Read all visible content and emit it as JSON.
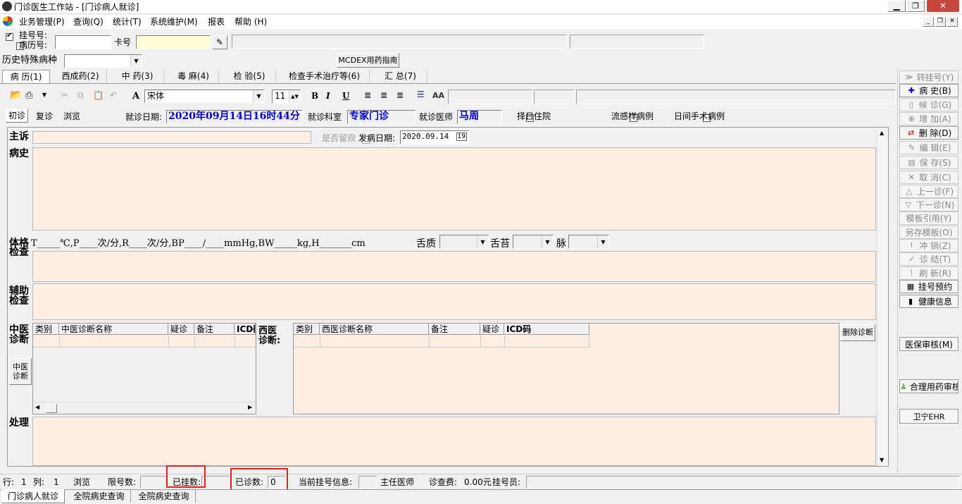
{
  "window": {
    "title": "门诊医生工作站 - [门诊病人就诊]"
  },
  "menu": [
    "业务管理(P)",
    "查询(Q)",
    "统计(T)",
    "系统维护(M)",
    "报表",
    "帮助 (H)"
  ],
  "patient_bar": {
    "reg_no_label": "挂号号:",
    "record_no_label": "病历号:",
    "card_label": "卡号",
    "reg_no_checked": true,
    "record_no_checked": false
  },
  "history": {
    "label": "历史特殊病种",
    "mcdex_button": "MCDEX用药指南"
  },
  "tabs": [
    "病 历(1)",
    "西成药(2)",
    "中 药(3)",
    "毒 麻(4)",
    "检 验(5)",
    "检查手术治疗等(6)",
    "汇 总(7)"
  ],
  "toolbar": {
    "font": "宋体",
    "size": "11",
    "bold": "B",
    "italic": "I",
    "underline": "U"
  },
  "visit": {
    "first": "初诊",
    "revisit": "复诊",
    "browse": "浏览",
    "date_label": "就诊日期:",
    "date_value": "2020年09月14日16时44分",
    "dept_label": "就诊科室",
    "dept_value": "专家门诊",
    "doctor_label": "就诊医师",
    "doctor_value": "马周",
    "select_day": "择日住院",
    "flu_case": "流感样病例",
    "day_surgery": "日间手术病例"
  },
  "record": {
    "chief_label": "主诉",
    "observe_label": "是否留观",
    "onset_label": "发病日期:",
    "onset_value": "2020.09.14",
    "history_label": "病史",
    "exam_label1": "体格",
    "exam_label2": "检查",
    "vitals_text": "T_____℃,P____次/分,R____次/分,BP____/____mmHg,BW_____kg,H_______cm",
    "tongue_label": "舌质",
    "coating_label": "舌苔",
    "pulse_label": "脉",
    "aux_label1": "辅助",
    "aux_label2": "检查",
    "tcm_label1": "中医",
    "tcm_label2": "诊断",
    "tcm_btn1": "中医",
    "tcm_btn2": "诊断",
    "west_label1": "西医",
    "west_label2": "诊断:",
    "treat_label": "处理",
    "delete_diag": "删除诊断"
  },
  "tcm_grid": {
    "headers": [
      "类别",
      "中医诊断名称",
      "疑诊",
      "备注",
      "ICD码"
    ]
  },
  "west_grid": {
    "headers": [
      "类别",
      "西医诊断名称",
      "备注",
      "疑诊",
      "ICD码"
    ]
  },
  "sidebar": [
    {
      "label": "转挂号(Y)",
      "icon": "forward-icon",
      "enabled": false
    },
    {
      "label": "病   史(B)",
      "icon": "plus-icon",
      "enabled": true
    },
    {
      "label": "候   诊(G)",
      "icon": "doc-icon",
      "enabled": false
    },
    {
      "label": "增   加(A)",
      "icon": "add-icon",
      "enabled": false
    },
    {
      "label": "删   除(D)",
      "icon": "delete-icon",
      "enabled": true
    },
    {
      "label": "编   辑(E)",
      "icon": "edit-icon",
      "enabled": false
    },
    {
      "label": "保   存(S)",
      "icon": "save-icon",
      "enabled": false
    },
    {
      "label": "取   消(C)",
      "icon": "cancel-icon",
      "enabled": false
    },
    {
      "label": "上一诊(F)",
      "icon": "up-icon",
      "enabled": false
    },
    {
      "label": "下一诊(N)",
      "icon": "down-icon",
      "enabled": false
    },
    {
      "label": "模板引用(Y)",
      "icon": "",
      "enabled": false
    },
    {
      "label": "另存模板(O)",
      "icon": "",
      "enabled": false
    },
    {
      "label": "冲   销(Z)",
      "icon": "reverse-icon",
      "enabled": false
    },
    {
      "label": "诊   结(T)",
      "icon": "check-icon",
      "enabled": false
    },
    {
      "label": "刷   新(R)",
      "icon": "refresh-icon",
      "enabled": false
    },
    {
      "label": "挂号预约",
      "icon": "book-icon",
      "enabled": true
    },
    {
      "label": "健康信息",
      "icon": "door-icon",
      "enabled": true
    }
  ],
  "sidebar_extra": {
    "audit": "医保审核(M)",
    "rational": "合理用药审核",
    "ehr": "卫宁EHR"
  },
  "status": {
    "row_label": "行:",
    "row_value": "1",
    "col_label": "列:",
    "col_value": "1",
    "browse": "浏览",
    "limit_label": "限号数:",
    "registered_label": "已挂数:",
    "diagnosed_label": "已诊数:",
    "diagnosed_value": "0",
    "current_reg": "当前挂号信息:",
    "chief_doctor": "主任医师",
    "fee_label": "诊查费:",
    "fee_value": "0.00元",
    "registrar_label": "挂号员:"
  },
  "bottom_tabs": [
    "门诊病人就诊",
    "全院病史查询",
    "全院病史查询"
  ]
}
